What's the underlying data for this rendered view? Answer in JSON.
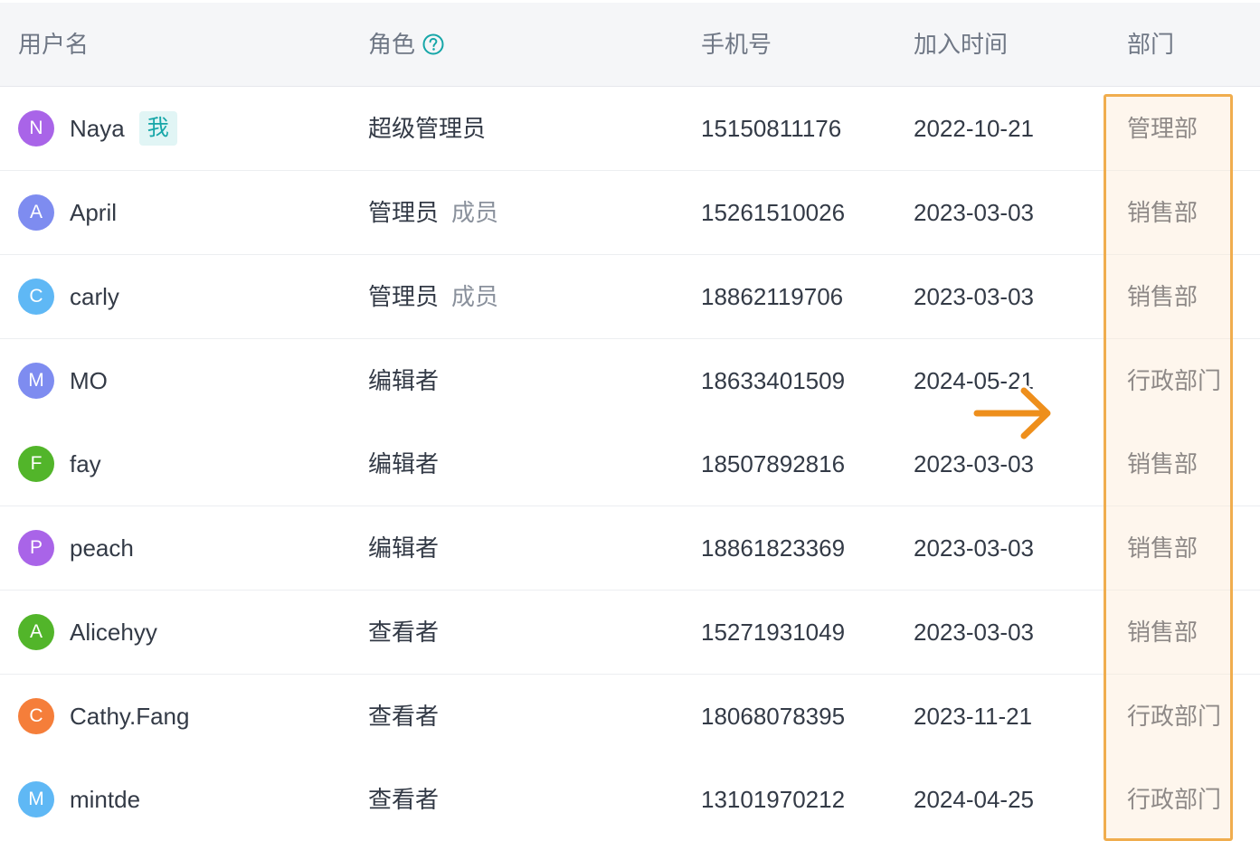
{
  "columns": {
    "username": "用户名",
    "role": "角色",
    "phone": "手机号",
    "joined": "加入时间",
    "department": "部门"
  },
  "me_tag": "我",
  "colors": {
    "highlight_border": "#f0ad4e",
    "arrow": "#ee8f1c",
    "help_icon": "#16a6a8"
  },
  "rows": [
    {
      "initial": "N",
      "avatar_color": "#a964e8",
      "name": "Naya",
      "is_me": true,
      "role": "超级管理员",
      "role_secondary": "",
      "phone": "15150811176",
      "joined": "2022-10-21",
      "department": "管理部"
    },
    {
      "initial": "A",
      "avatar_color": "#7e8cf0",
      "name": "April",
      "is_me": false,
      "role": "管理员",
      "role_secondary": "成员",
      "phone": "15261510026",
      "joined": "2023-03-03",
      "department": "销售部"
    },
    {
      "initial": "C",
      "avatar_color": "#5fb8f5",
      "name": "carly",
      "is_me": false,
      "role": "管理员",
      "role_secondary": "成员",
      "phone": "18862119706",
      "joined": "2023-03-03",
      "department": "销售部"
    },
    {
      "initial": "M",
      "avatar_color": "#7e8cf0",
      "name": "MO",
      "is_me": false,
      "role": "编辑者",
      "role_secondary": "",
      "phone": "18633401509",
      "joined": "2024-05-21",
      "department": "行政部门"
    },
    {
      "initial": "F",
      "avatar_color": "#52b52a",
      "name": "fay",
      "is_me": false,
      "role": "编辑者",
      "role_secondary": "",
      "phone": "18507892816",
      "joined": "2023-03-03",
      "department": "销售部"
    },
    {
      "initial": "P",
      "avatar_color": "#a964e8",
      "name": "peach",
      "is_me": false,
      "role": "编辑者",
      "role_secondary": "",
      "phone": "18861823369",
      "joined": "2023-03-03",
      "department": "销售部"
    },
    {
      "initial": "A",
      "avatar_color": "#52b52a",
      "name": "Alicehyy",
      "is_me": false,
      "role": "查看者",
      "role_secondary": "",
      "phone": "15271931049",
      "joined": "2023-03-03",
      "department": "销售部"
    },
    {
      "initial": "C",
      "avatar_color": "#f57e3a",
      "name": "Cathy.Fang",
      "is_me": false,
      "role": "查看者",
      "role_secondary": "",
      "phone": "18068078395",
      "joined": "2023-11-21",
      "department": "行政部门"
    },
    {
      "initial": "M",
      "avatar_color": "#5fb8f5",
      "name": "mintde",
      "is_me": false,
      "role": "查看者",
      "role_secondary": "",
      "phone": "13101970212",
      "joined": "2024-04-25",
      "department": "行政部门"
    }
  ]
}
